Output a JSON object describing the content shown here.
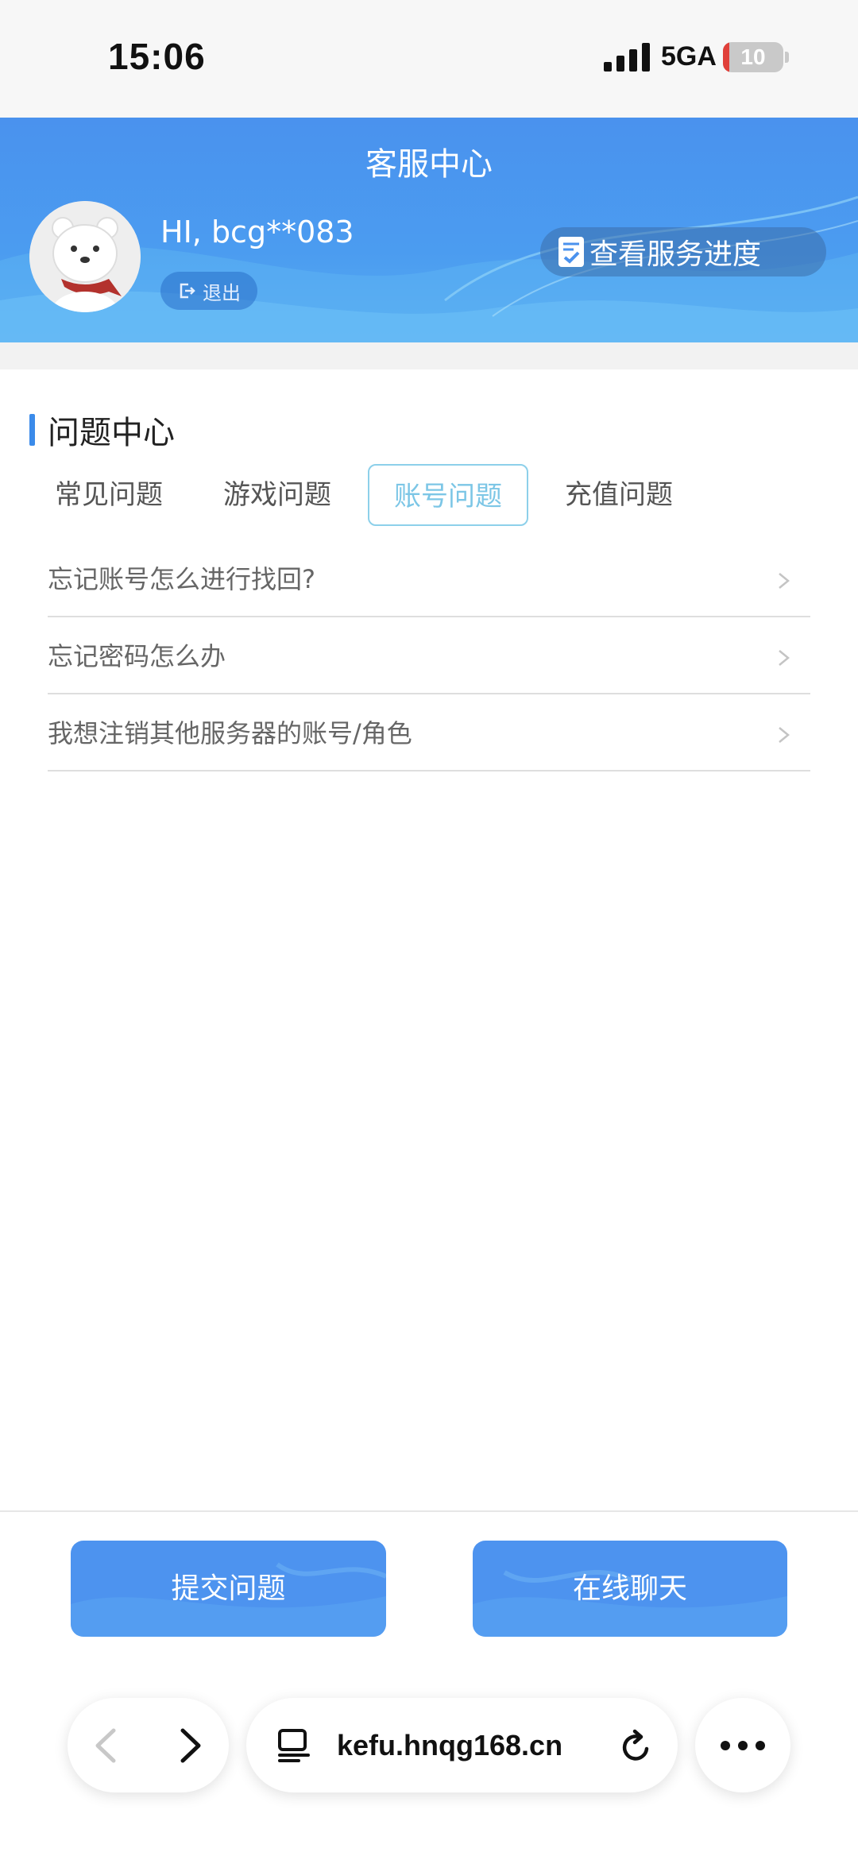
{
  "status_bar": {
    "time": "15:06",
    "network": "5GA",
    "battery_level": "10",
    "battery_fraction": 0.1,
    "battery_color": "#e0403a"
  },
  "header": {
    "title": "客服中心",
    "greeting": "HI, bcg**083",
    "logout_label": "退出",
    "progress_label": "查看服务进度",
    "brand_color": "#4a92ee"
  },
  "problem_center": {
    "title": "问题中心",
    "tabs": [
      {
        "label": "常见问题",
        "active": false
      },
      {
        "label": "游戏问题",
        "active": false
      },
      {
        "label": "账号问题",
        "active": true
      },
      {
        "label": "充值问题",
        "active": false
      }
    ],
    "questions": [
      "忘记账号怎么进行找回?",
      "忘记密码怎么办",
      "我想注销其他服务器的账号/角色"
    ]
  },
  "actions": {
    "submit_label": "提交问题",
    "chat_label": "在线聊天",
    "button_color": "#4d93ef"
  },
  "browser": {
    "url": "kefu.hnqg168.cn",
    "back_icon": "chevron-left-icon",
    "forward_icon": "chevron-right-icon",
    "page_icon": "page-format-icon",
    "reload_icon": "reload-icon",
    "more_icon": "more-dots-icon"
  }
}
